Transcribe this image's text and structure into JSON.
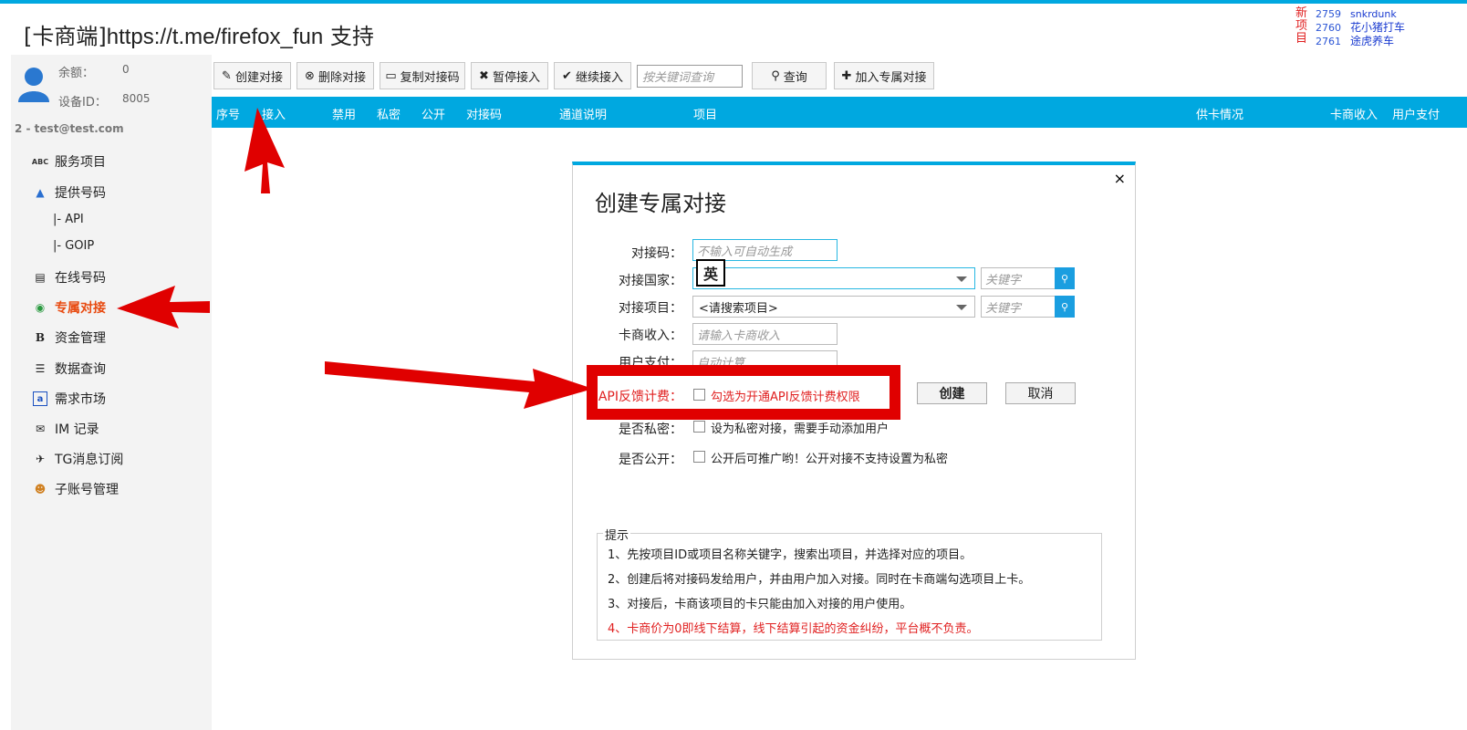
{
  "app": {
    "title_prefix": "[卡商端]",
    "title_url": "https://t.me/firefox_fun",
    "title_suffix": " 支持"
  },
  "new_projects": {
    "tag": "新项目",
    "items": [
      {
        "id": "2759",
        "name": "snkrdunk"
      },
      {
        "id": "2760",
        "name": "花小猪打车"
      },
      {
        "id": "2761",
        "name": "途虎养车"
      }
    ]
  },
  "account": {
    "balance_label": "余额：",
    "balance_value": "0",
    "device_label": "设备ID：",
    "device_value": "8005",
    "user_line": "2 - test@test.com"
  },
  "sidebar": {
    "items": [
      {
        "label": "服务项目",
        "icon": "abc-check-icon"
      },
      {
        "label": "提供号码",
        "icon": "up-arrow-icon"
      },
      {
        "label": "|- API",
        "icon": ""
      },
      {
        "label": "|- GOIP",
        "icon": ""
      },
      {
        "label": "在线号码",
        "icon": "list-icon"
      },
      {
        "label": "专属对接",
        "icon": "globe-icon",
        "active": true
      },
      {
        "label": "资金管理",
        "icon": "bold-b-icon"
      },
      {
        "label": "数据查询",
        "icon": "list-numbered-icon"
      },
      {
        "label": "需求市场",
        "icon": "a-badge-icon"
      },
      {
        "label": "IM 记录",
        "icon": "envelope-icon"
      },
      {
        "label": "TG消息订阅",
        "icon": "telegram-icon"
      },
      {
        "label": "子账号管理",
        "icon": "users-icon"
      }
    ]
  },
  "toolbar": {
    "create": "创建对接",
    "delete": "删除对接",
    "copy": "复制对接码",
    "pause": "暂停接入",
    "resume": "继续接入",
    "search_placeholder": "按关键词查询",
    "query": "查询",
    "join": "加入专属对接"
  },
  "table": {
    "columns": [
      "序号",
      "接入",
      "禁用",
      "私密",
      "公开",
      "对接码",
      "通道说明",
      "项目",
      "供卡情况",
      "卡商收入",
      "用户支付"
    ]
  },
  "modal": {
    "title": "创建专属对接",
    "close": "×",
    "fields": {
      "code_label": "对接码：",
      "code_placeholder": "不输入可自动生成",
      "country_label": "对接国家：",
      "country_value": "",
      "country_kw_placeholder": "关键字",
      "project_label": "对接项目：",
      "project_value": "<请搜索项目>",
      "project_kw_placeholder": "关键字",
      "income_label": "卡商收入：",
      "income_placeholder": "请输入卡商收入",
      "pay_label": "用户支付：",
      "pay_placeholder": "自动计算",
      "api_label": "API反馈计费：",
      "api_check_text": "勾选为开通API反馈计费权限",
      "private_label": "是否私密：",
      "private_check_text": "设为私密对接，需要手动添加用户",
      "public_label": "是否公开：",
      "public_check_text": "公开后可推广哟！公开对接不支持设置为私密"
    },
    "buttons": {
      "create": "创建",
      "cancel": "取消"
    },
    "ime_indicator": "英",
    "tips": {
      "legend": "提示",
      "lines": [
        "1、先按项目ID或项目名称关键字，搜索出项目，并选择对应的项目。",
        "2、创建后将对接码发给用户，并由用户加入对接。同时在卡商端勾选项目上卡。",
        "3、对接后，卡商该项目的卡只能由加入对接的用户使用。",
        "4、卡商价为0即线下结算，线下结算引起的资金纠纷，平台概不负责。"
      ]
    }
  },
  "colors": {
    "accent": "#00a8e0",
    "active_nav": "#e84a10",
    "warning_red": "#e02020",
    "annotation_red": "#e00000"
  }
}
